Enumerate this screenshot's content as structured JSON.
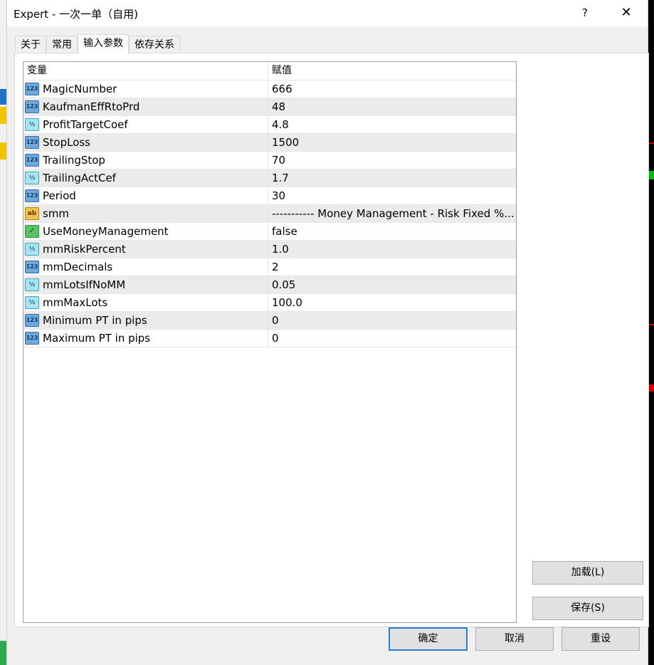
{
  "window": {
    "title": "Expert - 一次一单（自用)",
    "help_label": "?",
    "close_label": "✕"
  },
  "tabs": [
    "关于",
    "常用",
    "输入参数",
    "依存关系"
  ],
  "active_tab": "输入参数",
  "table": {
    "headers": {
      "variable": "变量",
      "value": "赋值"
    },
    "rows": [
      {
        "type": "int",
        "icon": "integer-type-icon",
        "badge": "123",
        "name": "MagicNumber",
        "value": "666"
      },
      {
        "type": "int",
        "icon": "integer-type-icon",
        "badge": "123",
        "name": "KaufmanEffRtoPrd",
        "value": "48"
      },
      {
        "type": "double",
        "icon": "double-type-icon",
        "badge": "½",
        "name": "ProfitTargetCoef",
        "value": "4.8"
      },
      {
        "type": "int",
        "icon": "integer-type-icon",
        "badge": "123",
        "name": "StopLoss",
        "value": "1500"
      },
      {
        "type": "int",
        "icon": "integer-type-icon",
        "badge": "123",
        "name": "TrailingStop",
        "value": "70"
      },
      {
        "type": "double",
        "icon": "double-type-icon",
        "badge": "½",
        "name": "TrailingActCef",
        "value": "1.7"
      },
      {
        "type": "int",
        "icon": "integer-type-icon",
        "badge": "123",
        "name": "Period",
        "value": "30"
      },
      {
        "type": "string",
        "icon": "string-type-icon",
        "badge": "ab",
        "name": "smm",
        "value": "----------- Money Management - Risk Fixed %..."
      },
      {
        "type": "bool",
        "icon": "boolean-type-icon",
        "badge": "✓",
        "name": "UseMoneyManagement",
        "value": "false"
      },
      {
        "type": "double",
        "icon": "double-type-icon",
        "badge": "½",
        "name": "mmRiskPercent",
        "value": "1.0"
      },
      {
        "type": "int",
        "icon": "integer-type-icon",
        "badge": "123",
        "name": "mmDecimals",
        "value": "2"
      },
      {
        "type": "double",
        "icon": "double-type-icon",
        "badge": "½",
        "name": "mmLotsIfNoMM",
        "value": "0.05"
      },
      {
        "type": "double",
        "icon": "double-type-icon",
        "badge": "½",
        "name": "mmMaxLots",
        "value": "100.0"
      },
      {
        "type": "int",
        "icon": "integer-type-icon",
        "badge": "123",
        "name": "Minimum PT in pips",
        "value": "0"
      },
      {
        "type": "int",
        "icon": "integer-type-icon",
        "badge": "123",
        "name": "Maximum PT in pips",
        "value": "0"
      }
    ]
  },
  "buttons": {
    "load": "加载(L)",
    "save": "保存(S)",
    "ok": "确定",
    "cancel": "取消",
    "reset": "重设"
  },
  "colors": {
    "row_alt": "#ebebeb",
    "default_button_border": "#2a7fd4",
    "dialog_background": "#f0f0f0"
  }
}
